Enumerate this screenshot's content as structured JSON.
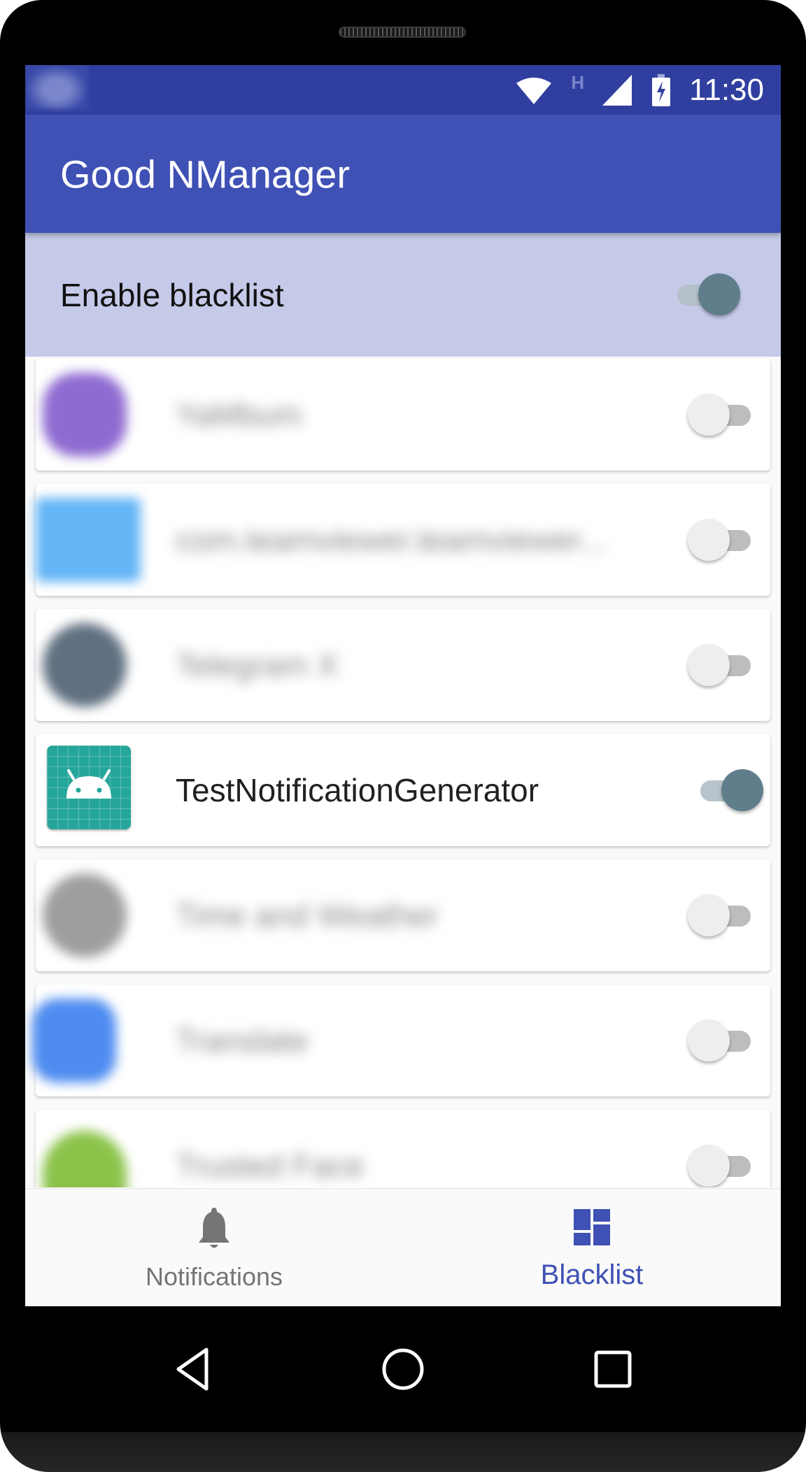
{
  "status_bar": {
    "time": "11:30",
    "network_type": "H",
    "icons": [
      "notification-blurred-icon",
      "wifi-icon",
      "cell-signal-icon",
      "battery-charging-icon"
    ]
  },
  "app_bar": {
    "title": "Good NManager"
  },
  "enable_blacklist": {
    "label": "Enable blacklist",
    "enabled": true
  },
  "apps": [
    {
      "name": "YaMbum",
      "blurred": true,
      "icon_color": "#8e6bd1",
      "blacklisted": false
    },
    {
      "name": "com.teamviewer.teamviewer...",
      "blurred": true,
      "icon_color": "#64b5f6",
      "blacklisted": false
    },
    {
      "name": "Telegram X",
      "blurred": true,
      "icon_color": "#607080",
      "blacklisted": false
    },
    {
      "name": "TestNotificationGenerator",
      "blurred": false,
      "icon_color": "#26a69a",
      "blacklisted": true
    },
    {
      "name": "Time and Weather",
      "blurred": true,
      "icon_color": "#9e9e9e",
      "blacklisted": false
    },
    {
      "name": "Translate",
      "blurred": true,
      "icon_color": "#4e8cf0",
      "blacklisted": false
    },
    {
      "name": "Trusted Face",
      "blurred": true,
      "icon_color": "#8bc34a",
      "blacklisted": false
    }
  ],
  "bottom_nav": {
    "items": [
      {
        "label": "Notifications",
        "icon": "bell-icon",
        "active": false
      },
      {
        "label": "Blacklist",
        "icon": "dashboard-icon",
        "active": true
      }
    ]
  },
  "system_nav": {
    "buttons": [
      "back",
      "home",
      "recents"
    ]
  },
  "colors": {
    "primary": "#3f51b5",
    "primary_dark": "#303f9f",
    "enable_row_bg": "#c5cae9",
    "switch_on": "#607d8b"
  }
}
